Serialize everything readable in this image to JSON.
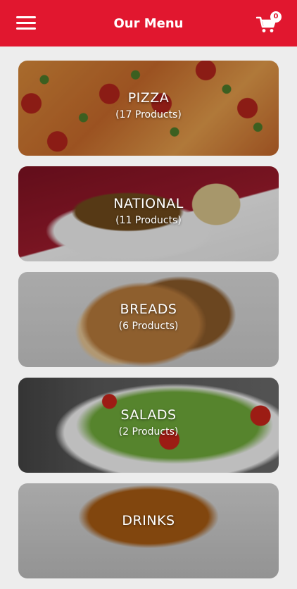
{
  "header": {
    "title": "Our Menu",
    "cart_count": "0",
    "background_color": "#e1172f"
  },
  "menu": {
    "categories": [
      {
        "name": "PIZZA",
        "count_label": "(17 Products)"
      },
      {
        "name": "NATIONAL",
        "count_label": "(11 Products)"
      },
      {
        "name": "BREADS",
        "count_label": "(6 Products)"
      },
      {
        "name": "SALADS",
        "count_label": "(2 Products)"
      },
      {
        "name": "DRINKS",
        "count_label": ""
      }
    ]
  },
  "icons": {
    "menu": "hamburger-menu-icon",
    "cart": "shopping-cart-icon"
  }
}
